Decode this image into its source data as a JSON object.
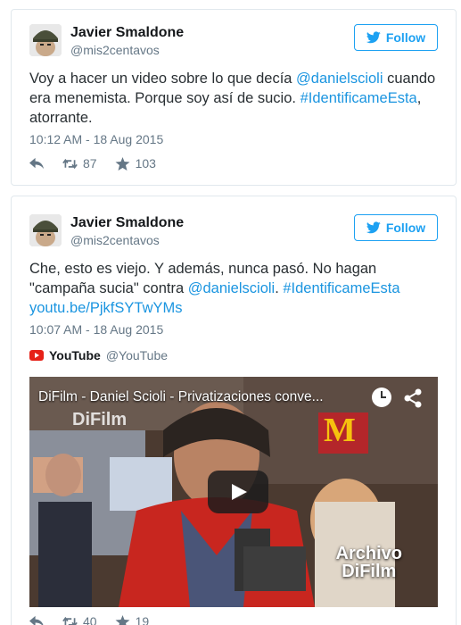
{
  "tweets": [
    {
      "author": {
        "name": "Javier Smaldone",
        "handle": "@mis2centavos"
      },
      "follow_label": "Follow",
      "text_parts": [
        "Voy a hacer un video sobre lo que decía ",
        "@danielscioli",
        " cuando era menemista. Porque soy así de sucio. ",
        "#IdentificameEsta",
        ", atorrante."
      ],
      "timestamp": "10:12 AM - 18 Aug 2015",
      "actions": {
        "retweets": "87",
        "likes": "103"
      }
    },
    {
      "author": {
        "name": "Javier Smaldone",
        "handle": "@mis2centavos"
      },
      "follow_label": "Follow",
      "text_parts": [
        "Che, esto es viejo. Y además, nunca pasó. No hagan \"campaña sucia\" contra ",
        "@danielscioli",
        ". ",
        "#IdentificameEsta",
        "youtu.be/PjkfSYTwYMs"
      ],
      "timestamp": "10:07 AM - 18 Aug 2015",
      "attribution": {
        "name": "YouTube",
        "handle": "@YouTube"
      },
      "video": {
        "title": "DiFilm - Daniel Scioli - Privatizaciones conve...",
        "watermark": "DiFilm",
        "archive_label_1": "Archivo",
        "archive_label_2": "DiFilm"
      },
      "actions": {
        "retweets": "40",
        "likes": "19"
      }
    }
  ],
  "icons": {
    "avatar": "avatar-helmet-icon",
    "follow": "twitter-bird-icon",
    "reply": "reply-icon",
    "retweet": "retweet-icon",
    "like": "star-icon",
    "youtube": "youtube-logo-icon",
    "clock": "watch-later-icon",
    "share": "share-icon",
    "play": "play-icon"
  },
  "colors": {
    "link": "#1b95e0",
    "follow": "#1da1f2",
    "meta": "#657786",
    "youtube": "#e62117"
  }
}
